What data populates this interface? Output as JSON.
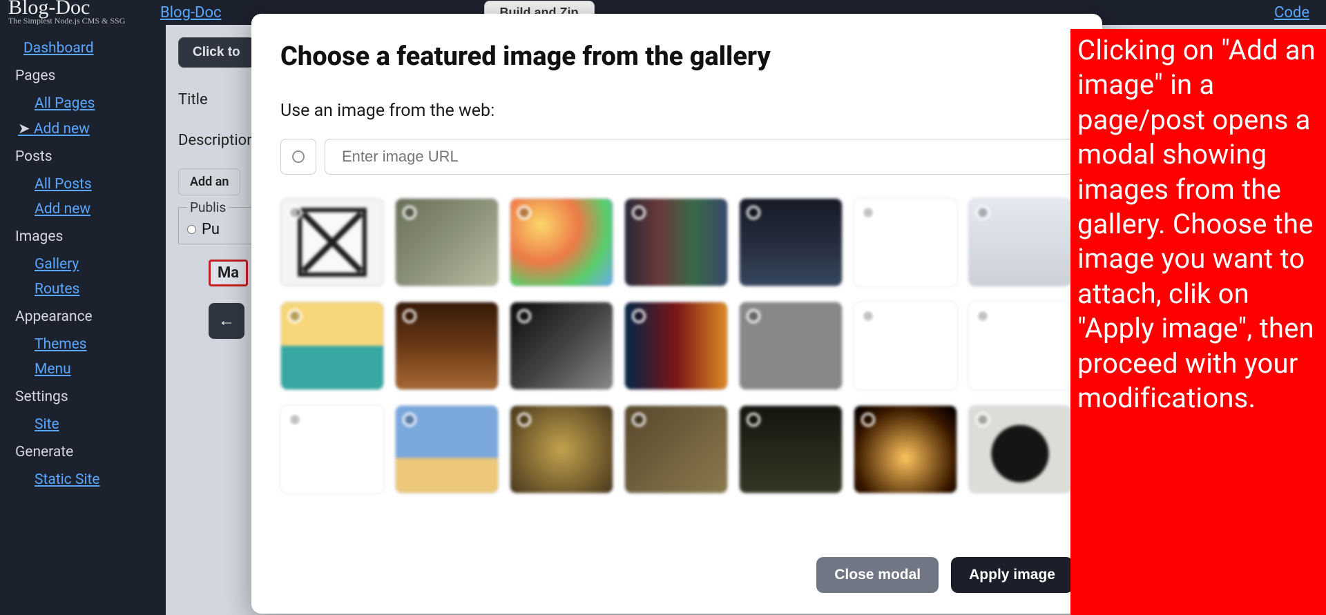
{
  "top": {
    "logo_title": "Blog-Doc",
    "logo_sub": "The Simplest Node.js CMS & SSG",
    "app_link": "Blog-Doc",
    "build_btn": "Build and Zip",
    "code_link": "Code"
  },
  "sidebar": {
    "dashboard": "Dashboard",
    "sections": {
      "pages": "Pages",
      "posts": "Posts",
      "images": "Images",
      "appearance": "Appearance",
      "settings": "Settings",
      "generate": "Generate"
    },
    "links": {
      "all_pages": "All Pages",
      "add_new_page": "Add new",
      "all_posts": "All Posts",
      "add_new_post": "Add new",
      "gallery": "Gallery",
      "routes": "Routes",
      "themes": "Themes",
      "menu": "Menu",
      "site": "Site",
      "static_site": "Static Site"
    }
  },
  "content": {
    "click_to": "Click to",
    "title_label": "Title",
    "desc_label": "Description",
    "add_image": "Add an",
    "publish_legend": "Publis",
    "publish_option": "Pu",
    "markdown_badge": "Ma",
    "back_arrow": "←"
  },
  "modal": {
    "title": "Choose a featured image from the gallery",
    "use_web": "Use an image from the web:",
    "url_placeholder": "Enter image URL",
    "close_x": "×",
    "close_btn": "Close modal",
    "apply_btn": "Apply image",
    "gallery_count": 21
  },
  "callout": {
    "text": "Clicking on \"Add an image\" in a page/post opens a modal showing images from the gallery. Choose the image you want to attach, clik on \"Apply image\", then proceed with your modifications."
  }
}
